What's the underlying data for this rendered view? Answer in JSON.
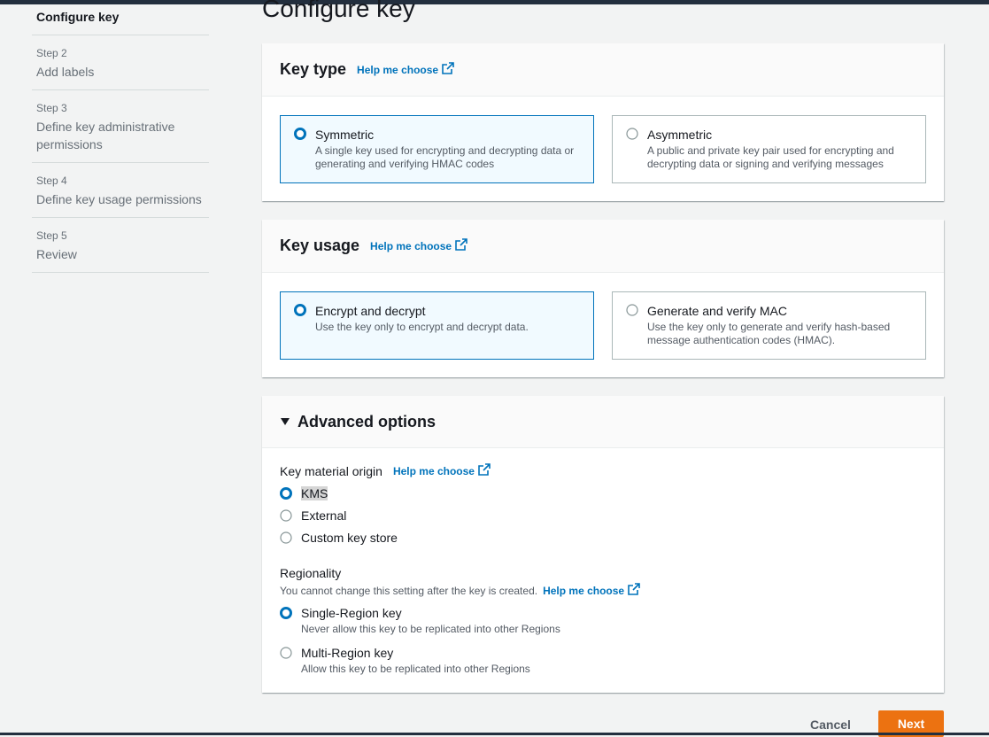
{
  "sidebar": {
    "current": "Configure key",
    "steps": [
      {
        "num": "Step 2",
        "title": "Add labels"
      },
      {
        "num": "Step 3",
        "title": "Define key administrative permissions"
      },
      {
        "num": "Step 4",
        "title": "Define key usage permissions"
      },
      {
        "num": "Step 5",
        "title": "Review"
      }
    ]
  },
  "page_title": "Configure key",
  "key_type": {
    "title": "Key type",
    "help": "Help me choose",
    "options": [
      {
        "label": "Symmetric",
        "desc": "A single key used for encrypting and decrypting data or generating and verifying HMAC codes",
        "selected": true
      },
      {
        "label": "Asymmetric",
        "desc": "A public and private key pair used for encrypting and decrypting data or signing and verifying messages",
        "selected": false
      }
    ]
  },
  "key_usage": {
    "title": "Key usage",
    "help": "Help me choose",
    "options": [
      {
        "label": "Encrypt and decrypt",
        "desc": "Use the key only to encrypt and decrypt data.",
        "selected": true
      },
      {
        "label": "Generate and verify MAC",
        "desc": "Use the key only to generate and verify hash-based message authentication codes (HMAC).",
        "selected": false
      }
    ]
  },
  "advanced": {
    "title": "Advanced options",
    "origin_label": "Key material origin",
    "origin_help": "Help me choose",
    "origin_options": [
      {
        "label": "KMS",
        "selected": true
      },
      {
        "label": "External",
        "selected": false
      },
      {
        "label": "Custom key store",
        "selected": false
      }
    ],
    "regionality_label": "Regionality",
    "regionality_desc": "You cannot change this setting after the key is created.",
    "regionality_help": "Help me choose",
    "region_options": [
      {
        "label": "Single-Region key",
        "desc": "Never allow this key to be replicated into other Regions",
        "selected": true
      },
      {
        "label": "Multi-Region key",
        "desc": "Allow this key to be replicated into other Regions",
        "selected": false
      }
    ]
  },
  "buttons": {
    "cancel": "Cancel",
    "next": "Next"
  },
  "colors": {
    "accent": "#0073bb",
    "primary_button": "#ec7211",
    "selected_tile_bg": "#f1faff"
  },
  "icons": {
    "external_link": "external-link-icon",
    "caret": "caret-down-icon"
  }
}
